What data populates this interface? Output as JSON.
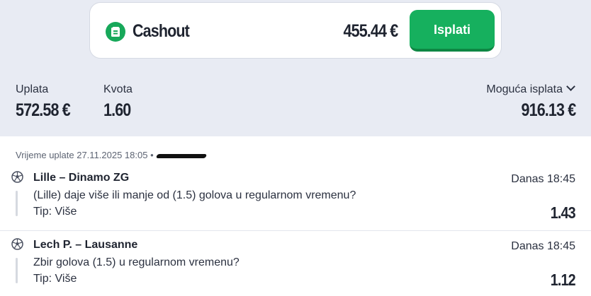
{
  "cashout": {
    "label": "Cashout",
    "amount": "455.44 €",
    "button_label": "Isplati",
    "icon": "ticket-icon",
    "accent_color": "#16b05e"
  },
  "summary": {
    "stake_label": "Uplata",
    "stake_value": "572.58 €",
    "odds_label": "Kvota",
    "odds_value": "1.60",
    "payout_label": "Moguća isplata",
    "payout_value": "916.13 €"
  },
  "ticket": {
    "placed_text": "Vrijeme uplate 27.11.2025 18:05 •",
    "events": [
      {
        "match": "Lille – Dinamo ZG",
        "time": "Danas 18:45",
        "question": "(Lille) daje više ili manje od (1.5) golova u regularnom vremenu?",
        "tip": "Tip: Više",
        "odd": "1.43",
        "icon": "football-icon"
      },
      {
        "match": "Lech P. – Lausanne",
        "time": "Danas 18:45",
        "question": "Zbir golova (1.5) u regularnom vremenu?",
        "tip": "Tip: Više",
        "odd": "1.12",
        "icon": "football-icon"
      }
    ]
  }
}
